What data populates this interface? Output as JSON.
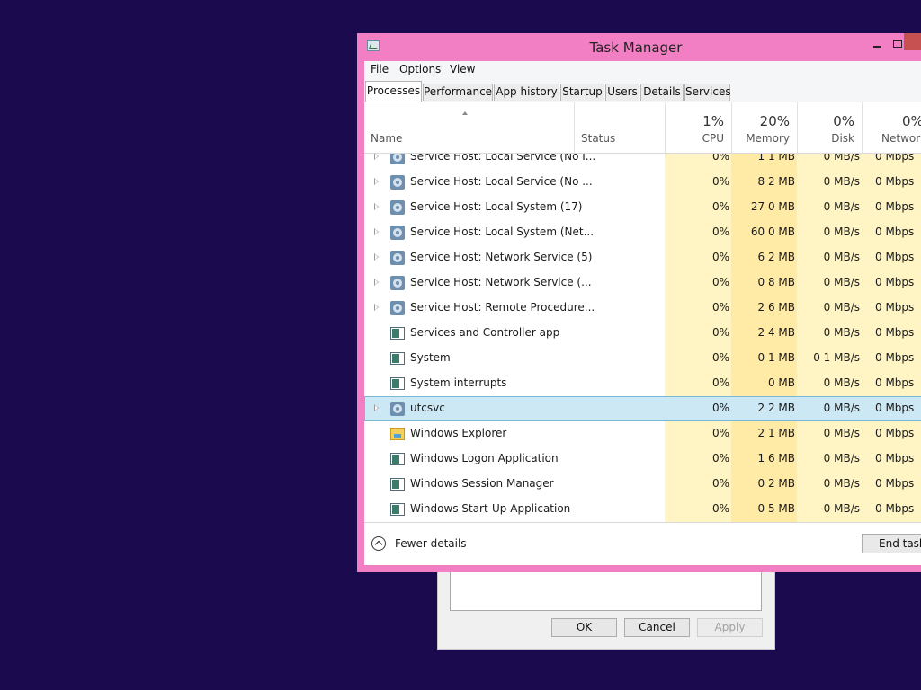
{
  "background_dialog": {
    "ok_label": "OK",
    "cancel_label": "Cancel",
    "apply_label": "Apply"
  },
  "window": {
    "title": "Task Manager",
    "frame_color": "#f27fc3"
  },
  "menu": [
    "File",
    "Options",
    "View"
  ],
  "tabs": [
    "Processes",
    "Performance",
    "App history",
    "Startup",
    "Users",
    "Details",
    "Services"
  ],
  "active_tab": "Processes",
  "columns": {
    "name": "Name",
    "status": "Status",
    "cpu": {
      "pct": "1%",
      "label": "CPU"
    },
    "memory": {
      "pct": "20%",
      "label": "Memory"
    },
    "disk": {
      "pct": "0%",
      "label": "Disk"
    },
    "network": {
      "pct": "0%",
      "label": "Network"
    }
  },
  "processes": [
    {
      "name": "Service Host: Local Service (No I...",
      "cpu": "0%",
      "memory": "1 1 MB",
      "disk": "0 MB/s",
      "network": "0 Mbps",
      "icon": "gear-icon",
      "expandable": true
    },
    {
      "name": "Service Host: Local Service (No ...",
      "cpu": "0%",
      "memory": "8 2 MB",
      "disk": "0 MB/s",
      "network": "0 Mbps",
      "icon": "gear-icon",
      "expandable": true
    },
    {
      "name": "Service Host: Local System (17)",
      "cpu": "0%",
      "memory": "27 0 MB",
      "disk": "0 MB/s",
      "network": "0 Mbps",
      "icon": "gear-icon",
      "expandable": true
    },
    {
      "name": "Service Host: Local System (Net...",
      "cpu": "0%",
      "memory": "60 0 MB",
      "disk": "0 MB/s",
      "network": "0 Mbps",
      "icon": "gear-icon",
      "expandable": true
    },
    {
      "name": "Service Host: Network Service (5)",
      "cpu": "0%",
      "memory": "6 2 MB",
      "disk": "0 MB/s",
      "network": "0 Mbps",
      "icon": "gear-icon",
      "expandable": true
    },
    {
      "name": "Service Host: Network Service (...",
      "cpu": "0%",
      "memory": "0 8 MB",
      "disk": "0 MB/s",
      "network": "0 Mbps",
      "icon": "gear-icon",
      "expandable": true
    },
    {
      "name": "Service Host: Remote Procedure...",
      "cpu": "0%",
      "memory": "2 6 MB",
      "disk": "0 MB/s",
      "network": "0 Mbps",
      "icon": "gear-icon",
      "expandable": true
    },
    {
      "name": "Services and Controller app",
      "cpu": "0%",
      "memory": "2 4 MB",
      "disk": "0 MB/s",
      "network": "0 Mbps",
      "icon": "app-icon",
      "expandable": false
    },
    {
      "name": "System",
      "cpu": "0%",
      "memory": "0 1 MB",
      "disk": "0 1 MB/s",
      "network": "0 Mbps",
      "icon": "app-icon",
      "expandable": false
    },
    {
      "name": "System interrupts",
      "cpu": "0%",
      "memory": "0 MB",
      "disk": "0 MB/s",
      "network": "0 Mbps",
      "icon": "app-icon",
      "expandable": false
    },
    {
      "name": "utcsvc",
      "cpu": "0%",
      "memory": "2 2 MB",
      "disk": "0 MB/s",
      "network": "0 Mbps",
      "icon": "gear-icon",
      "expandable": true,
      "selected": true
    },
    {
      "name": "Windows Explorer",
      "cpu": "0%",
      "memory": "2 1 MB",
      "disk": "0 MB/s",
      "network": "0 Mbps",
      "icon": "folder-icon",
      "expandable": false
    },
    {
      "name": "Windows Logon Application",
      "cpu": "0%",
      "memory": "1 6 MB",
      "disk": "0 MB/s",
      "network": "0 Mbps",
      "icon": "app-icon",
      "expandable": false
    },
    {
      "name": "Windows Session Manager",
      "cpu": "0%",
      "memory": "0 2 MB",
      "disk": "0 MB/s",
      "network": "0 Mbps",
      "icon": "app-icon",
      "expandable": false
    },
    {
      "name": "Windows Start-Up Application",
      "cpu": "0%",
      "memory": "0 5 MB",
      "disk": "0 MB/s",
      "network": "0 Mbps",
      "icon": "app-icon",
      "expandable": false
    }
  ],
  "footer": {
    "fewer_details": "Fewer details",
    "end_task": "End task"
  },
  "colors": {
    "desktop": "#1c0a4e",
    "heat_low": "#fff4c4",
    "heat_mid": "#ffeaa6",
    "selection": "#cce8f4"
  }
}
